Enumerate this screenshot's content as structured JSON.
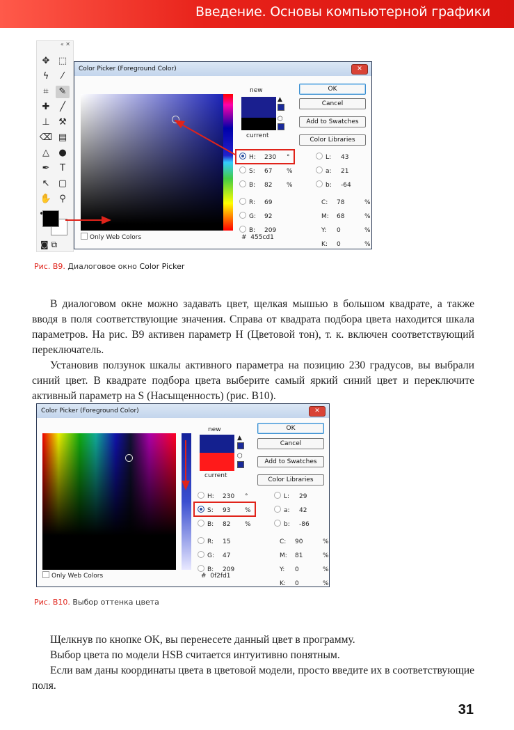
{
  "header": {
    "title": "Введение. Основы компьютерной графики",
    "bar_color": "#e8221a"
  },
  "toolbar": {
    "top_controls": "« ✕",
    "tools": [
      {
        "name": "move-tool",
        "glyph": "✥"
      },
      {
        "name": "marquee-tool",
        "glyph": "⬚"
      },
      {
        "name": "lasso-tool",
        "glyph": "ϟ"
      },
      {
        "name": "magic-wand-tool",
        "glyph": "⁄"
      },
      {
        "name": "crop-tool",
        "glyph": "⌗"
      },
      {
        "name": "eyedropper-tool",
        "glyph": "✎"
      },
      {
        "name": "healing-tool",
        "glyph": "✚"
      },
      {
        "name": "brush-tool",
        "glyph": "╱"
      },
      {
        "name": "stamp-tool",
        "glyph": "⊥"
      },
      {
        "name": "history-brush-tool",
        "glyph": "⚒"
      },
      {
        "name": "eraser-tool",
        "glyph": "⌫"
      },
      {
        "name": "gradient-tool",
        "glyph": "▤"
      },
      {
        "name": "blur-tool",
        "glyph": "△"
      },
      {
        "name": "dodge-tool",
        "glyph": "●"
      },
      {
        "name": "pen-tool",
        "glyph": "✒"
      },
      {
        "name": "type-tool",
        "glyph": "T"
      },
      {
        "name": "path-selection-tool",
        "glyph": "↖"
      },
      {
        "name": "shape-tool",
        "glyph": "▢"
      },
      {
        "name": "hand-tool",
        "glyph": "✋"
      },
      {
        "name": "zoom-tool",
        "glyph": "⚲"
      },
      {
        "name": "more-tools",
        "glyph": "•••"
      }
    ],
    "bottom": "◙ ⧉"
  },
  "dialog1": {
    "title": "Color Picker (Foreground Color)",
    "close": "✕",
    "new_label": "new",
    "current_label": "current",
    "new_color": "#1a1f8f",
    "current_color": "#000000",
    "buttons": {
      "ok": "OK",
      "cancel": "Cancel",
      "add_to_swatches": "Add to Swatches",
      "color_libraries": "Color Libraries"
    },
    "fields": {
      "H": {
        "label": "H:",
        "value": "230",
        "unit": "°",
        "active": true
      },
      "S": {
        "label": "S:",
        "value": "67",
        "unit": "%"
      },
      "Bv": {
        "label": "B:",
        "value": "82",
        "unit": "%"
      },
      "R": {
        "label": "R:",
        "value": "69"
      },
      "G": {
        "label": "G:",
        "value": "92"
      },
      "Bc": {
        "label": "B:",
        "value": "209"
      },
      "L": {
        "label": "L:",
        "value": "43"
      },
      "a": {
        "label": "a:",
        "value": "21"
      },
      "b": {
        "label": "b:",
        "value": "-64"
      },
      "C": {
        "label": "C:",
        "value": "78",
        "unit": "%"
      },
      "M": {
        "label": "M:",
        "value": "68",
        "unit": "%"
      },
      "Y": {
        "label": "Y:",
        "value": "0",
        "unit": "%"
      },
      "K": {
        "label": "K:",
        "value": "0",
        "unit": "%"
      }
    },
    "hex_label": "#",
    "hex": "455cd1",
    "only_web_colors": "Only Web Colors"
  },
  "caption1": {
    "fig": "Рис. B9.",
    "text": " Диалоговое окно ",
    "strong": "Color Picker"
  },
  "text1": [
    "В диалоговом окне можно задавать цвет, щелкая мышью в большом квадрате, а также вводя в поля соответствующие значения. Справа от квадрата подбора цвета находится шкала параметров. На рис. B9 активен параметр H (Цветовой тон), т. к. включен соответствующий переключатель.",
    "Установив ползунок шкалы активного параметра на позицию 230 градусов, вы выбрали синий цвет. В квадрате подбора цвета выберите самый яркий синий цвет и переключите активный параметр на S (Насыщенность) (рис. B10)."
  ],
  "dialog2": {
    "title": "Color Picker (Foreground Color)",
    "close": "✕",
    "new_label": "new",
    "current_label": "current",
    "new_color": "#14208f",
    "current_color": "#ff1a1a",
    "buttons": {
      "ok": "OK",
      "cancel": "Cancel",
      "add_to_swatches": "Add to Swatches",
      "color_libraries": "Color Libraries"
    },
    "fields": {
      "H": {
        "label": "H:",
        "value": "230",
        "unit": "°"
      },
      "S": {
        "label": "S:",
        "value": "93",
        "unit": "%",
        "active": true
      },
      "Bv": {
        "label": "B:",
        "value": "82",
        "unit": "%"
      },
      "R": {
        "label": "R:",
        "value": "15"
      },
      "G": {
        "label": "G:",
        "value": "47"
      },
      "Bc": {
        "label": "B:",
        "value": "209"
      },
      "L": {
        "label": "L:",
        "value": "29"
      },
      "a": {
        "label": "a:",
        "value": "42"
      },
      "b": {
        "label": "b:",
        "value": "-86"
      },
      "C": {
        "label": "C:",
        "value": "90",
        "unit": "%"
      },
      "M": {
        "label": "M:",
        "value": "81",
        "unit": "%"
      },
      "Y": {
        "label": "Y:",
        "value": "0",
        "unit": "%"
      },
      "K": {
        "label": "K:",
        "value": "0",
        "unit": "%"
      }
    },
    "hex_label": "#",
    "hex": "0f2fd1",
    "only_web_colors": "Only Web Colors"
  },
  "caption2": {
    "fig": "Рис. B10.",
    "text": " Выбор оттенка цвета"
  },
  "text2": [
    "Щелкнув по кнопке OK, вы перенесете данный цвет в программу.",
    "Выбор цвета по модели HSB считается интуитивно понятным.",
    "Если вам даны координаты цвета в цветовой модели, просто введите их в соответствующие поля."
  ],
  "page_number": "31"
}
